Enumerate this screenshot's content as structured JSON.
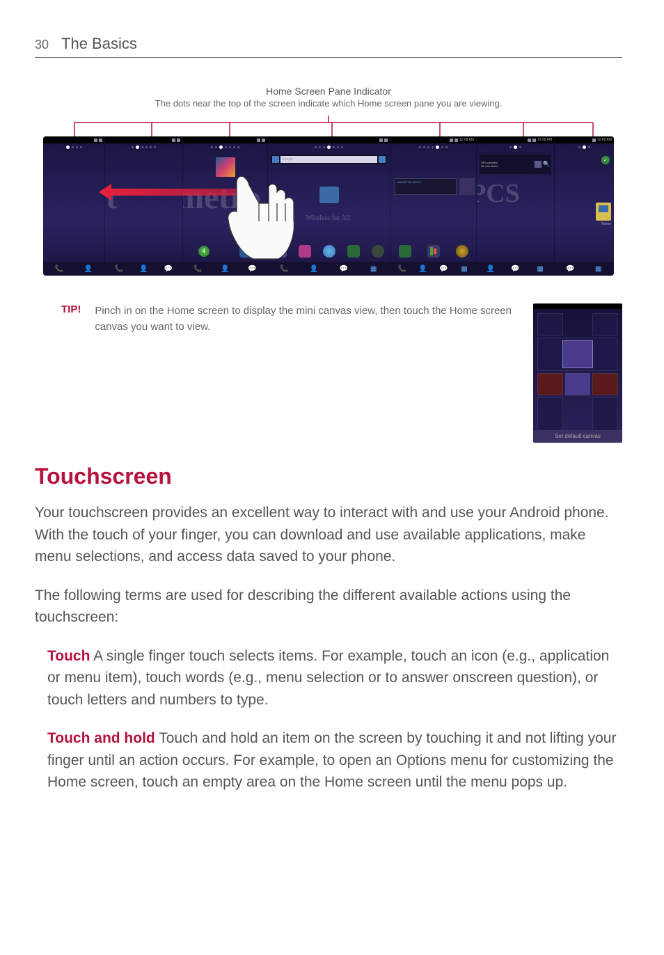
{
  "page": {
    "number": "30",
    "header": "The Basics"
  },
  "indicator": {
    "title": "Home Screen Pane Indicator",
    "subtitle": "The dots near the top of the screen indicate which Home screen pane you are viewing."
  },
  "diagram": {
    "screen_time": "10:08 AM",
    "google_placeholder": "Google",
    "music_widget": "UNLIMITED MUSIC",
    "wallpaper_fragments": [
      "r",
      "met",
      "metro",
      "PCS"
    ],
    "wallpaper_sub": "Wireless for All.",
    "bottom_labels": [
      "Phone",
      "Contacts",
      "Messaging",
      "Applications"
    ],
    "memo_label": "Memo"
  },
  "tip": {
    "label": "TIP!",
    "text": "Pinch in on the Home screen to display the mini canvas view, then touch the Home screen canvas you want to view."
  },
  "mini_canvas": {
    "button": "Set default canvas"
  },
  "section": {
    "title": "Touchscreen",
    "intro": "Your touchscreen provides an excellent way to interact with and use your Android phone. With the touch of your finger, you can download and use available applications, make menu selections, and access data saved to your phone.",
    "intro2": "The following terms are used for describing the different available actions using the touchscreen:",
    "touch_label": "Touch",
    "touch_text": "  A single finger touch selects items. For example, touch an icon (e.g., application or menu item), touch words (e.g., menu selection or to answer onscreen question), or touch letters and numbers to type.",
    "touchhold_label": "Touch and hold",
    "touchhold_text": "  Touch and hold an item on the screen by touching it and not lifting your finger until an action occurs. For example, to open an Options menu for customizing the Home screen, touch an empty area on the Home screen until the menu pops up."
  }
}
